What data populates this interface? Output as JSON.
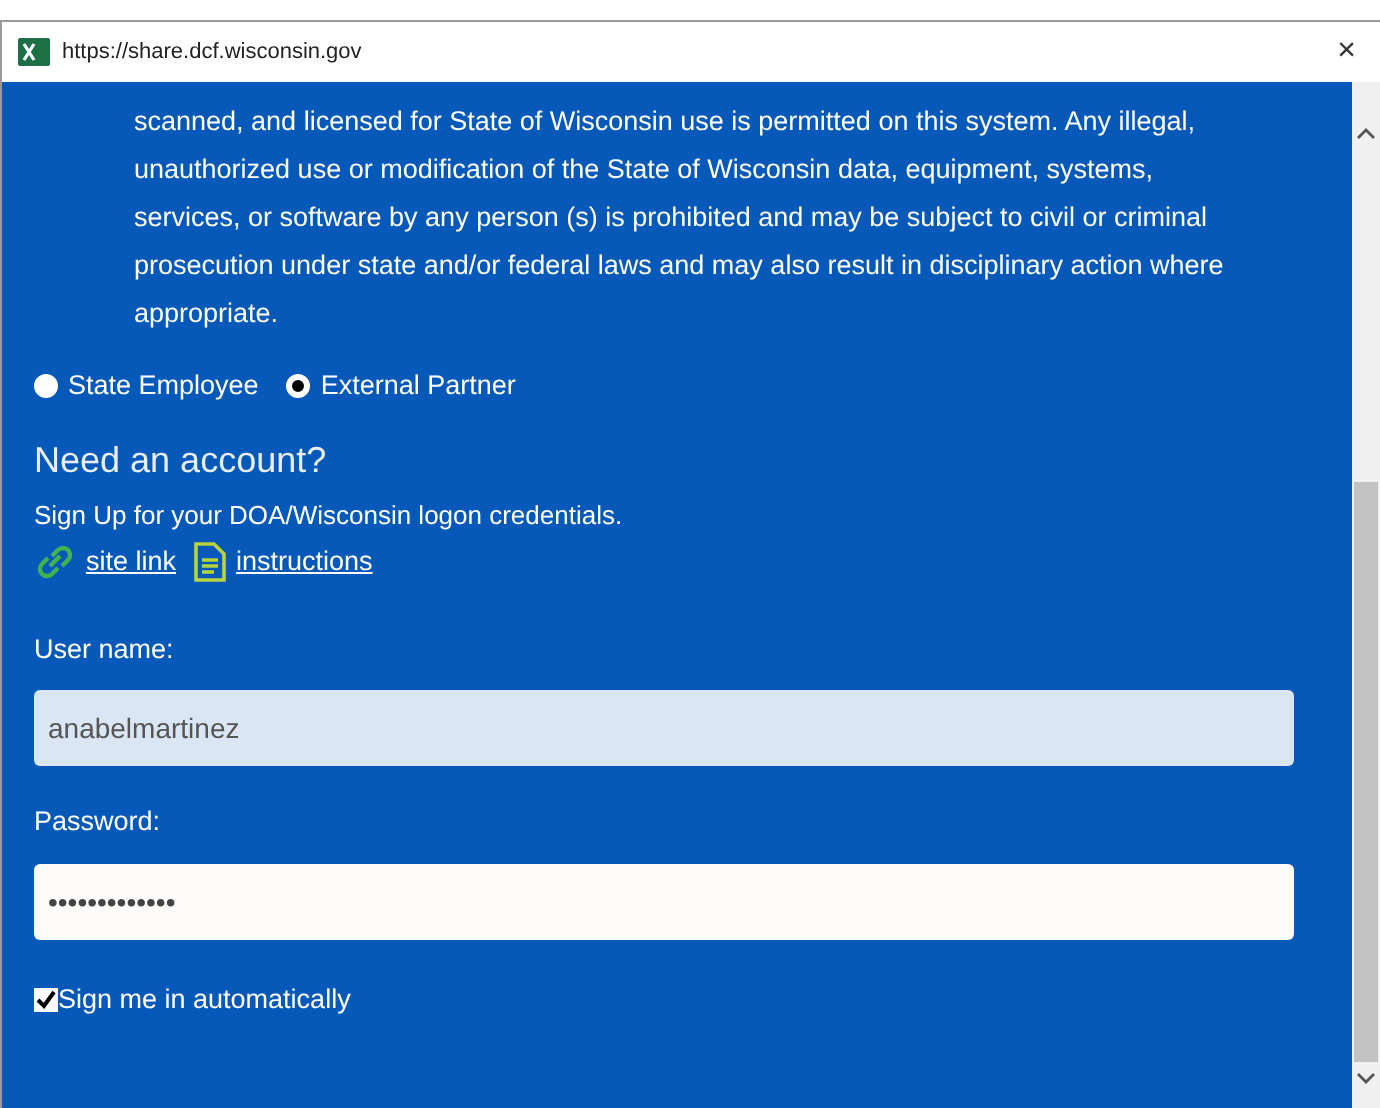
{
  "window": {
    "title": "https://share.dcf.wisconsin.gov",
    "close": "×"
  },
  "notice": "scanned, and licensed for State of Wisconsin use is permitted on this system. Any illegal, unauthorized use or modification of the State of Wisconsin data, equipment, systems, services, or software by any person (s) is prohibited and may be subject to civil or criminal prosecution under state and/or federal laws and may also result in disciplinary action where appropriate.",
  "user_type": [
    {
      "label": "State Employee",
      "selected": false
    },
    {
      "label": "External Partner",
      "selected": true
    }
  ],
  "signup": {
    "heading": "Need an account?",
    "text": "Sign Up for your DOA/Wisconsin logon credentials.",
    "links": [
      {
        "kind": "link",
        "label": "site link"
      },
      {
        "kind": "document",
        "label": "instructions"
      }
    ]
  },
  "username": {
    "label": "User name:",
    "value": "anabelmartinez"
  },
  "password": {
    "label": "Password:",
    "value": "•••••••••••••"
  },
  "remember": {
    "label": "Sign me in automatically",
    "checked": true
  }
}
